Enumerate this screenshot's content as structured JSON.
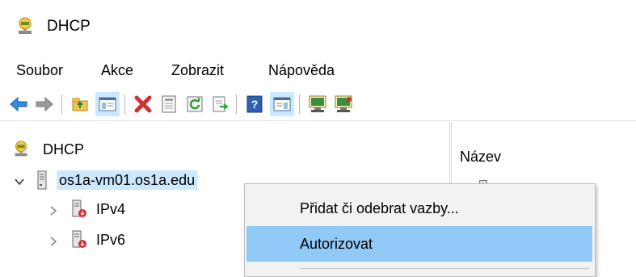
{
  "window": {
    "title": "DHCP"
  },
  "menu": [
    "Soubor",
    "Akce",
    "Zobrazit",
    "Nápověda"
  ],
  "toolbar": {
    "buttons": [
      "back-arrow-icon",
      "forward-arrow-icon",
      "up-folder-icon",
      "show-hide-tree-icon",
      "delete-icon",
      "properties-icon",
      "refresh-icon",
      "export-list-icon",
      "help-icon",
      "show-action-pane-icon",
      "authorize-server-icon",
      "unauthorize-server-icon"
    ]
  },
  "tree": {
    "root": "DHCP",
    "server": "os1a-vm01.os1a.edu",
    "children": [
      "IPv4",
      "IPv6"
    ]
  },
  "right_pane": {
    "column_header": "Název"
  },
  "context_menu": {
    "items": [
      "Přidat či odebrat vazby...",
      "Autorizovat"
    ],
    "highlighted": "Autorizovat"
  },
  "colors": {
    "selection": "#cce8ff",
    "menu_highlight": "#91c9f7",
    "menu_background": "#f2f2f2"
  }
}
